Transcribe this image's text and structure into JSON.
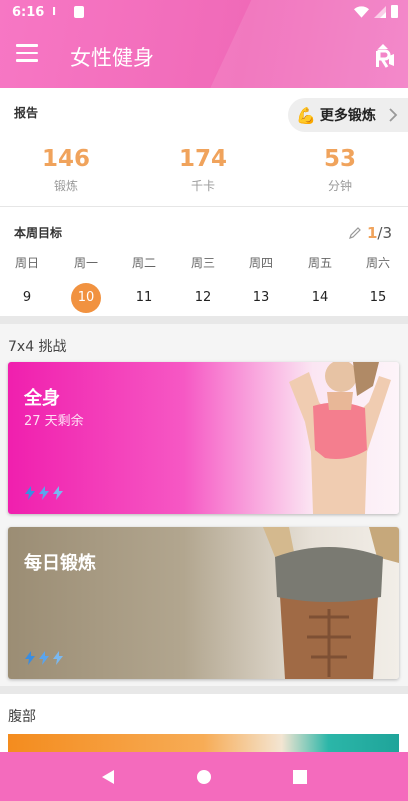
{
  "status": {
    "time": "6:16",
    "icon_text": "ᅚ"
  },
  "appbar": {
    "title": "女性健身",
    "menu_icon": "menu-icon",
    "coach_icon": "coach-icon"
  },
  "report": {
    "label": "报告",
    "more_button": {
      "emoji": "💪",
      "label": "更多锻炼"
    },
    "stats": [
      {
        "value": "146",
        "unit": "锻炼"
      },
      {
        "value": "174",
        "unit": "千卡"
      },
      {
        "value": "53",
        "unit": "分钟"
      }
    ]
  },
  "weekly_goal": {
    "label": "本周目标",
    "done": "1",
    "total": "/3",
    "days": [
      {
        "name": "周日",
        "date": "9"
      },
      {
        "name": "周一",
        "date": "10",
        "today": true
      },
      {
        "name": "周二",
        "date": "11"
      },
      {
        "name": "周三",
        "date": "12"
      },
      {
        "name": "周四",
        "date": "13"
      },
      {
        "name": "周五",
        "date": "14"
      },
      {
        "name": "周六",
        "date": "15"
      }
    ]
  },
  "challenge": {
    "label": "7x4 挑战",
    "cards": [
      {
        "title": "全身",
        "subtitle": "27 天剩余"
      },
      {
        "title": "每日锻炼",
        "subtitle": ""
      }
    ]
  },
  "abs": {
    "label": "腹部"
  },
  "colors": {
    "accent": "#f06ab8",
    "orange": "#f0a35c",
    "today": "#f19240",
    "bolt": "#3a8de0"
  }
}
